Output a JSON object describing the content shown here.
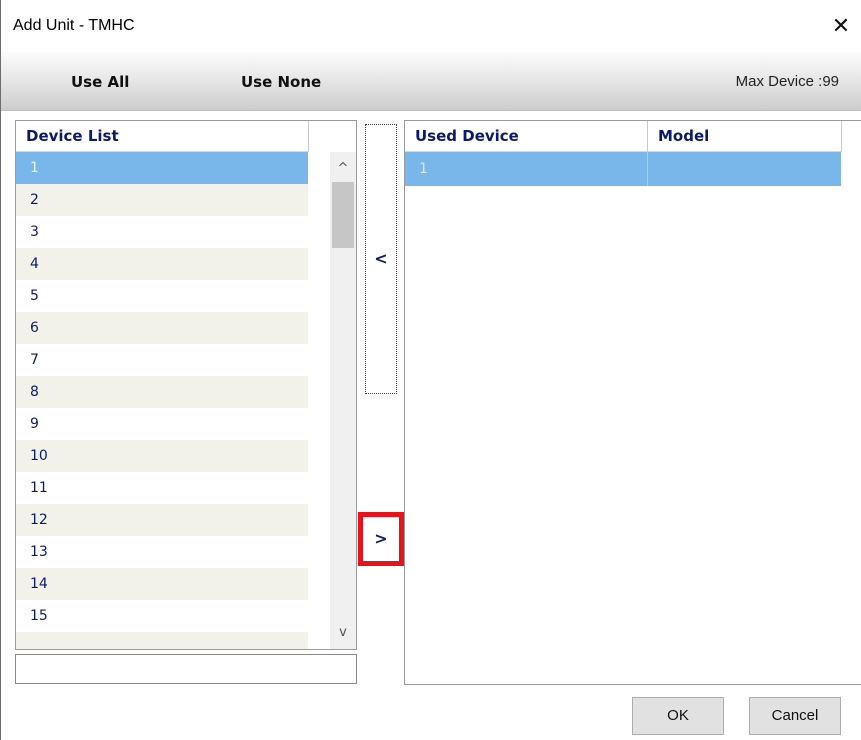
{
  "window": {
    "title": "Add Unit - TMHC",
    "close_glyph": "✕"
  },
  "toolbar": {
    "use_all": "Use All",
    "use_none": "Use None",
    "max_device": "Max Device :99"
  },
  "device_list": {
    "header": "Device List",
    "items": [
      "1",
      "2",
      "3",
      "4",
      "5",
      "6",
      "7",
      "8",
      "9",
      "10",
      "11",
      "12",
      "13",
      "14",
      "15"
    ],
    "selected_index": 0
  },
  "move_buttons": {
    "remove_label": "<",
    "add_label": ">"
  },
  "used_devices": {
    "headers": [
      "Used Device",
      "Model"
    ],
    "rows": [
      {
        "device": "1",
        "model": ""
      }
    ]
  },
  "scrollbar": {
    "up": "^",
    "down": "v"
  },
  "buttons": {
    "ok": "OK",
    "cancel": "Cancel"
  },
  "colors": {
    "selection": "#79b7ea",
    "highlight_border": "#e8121b",
    "text_blue": "#0b1b6b"
  }
}
